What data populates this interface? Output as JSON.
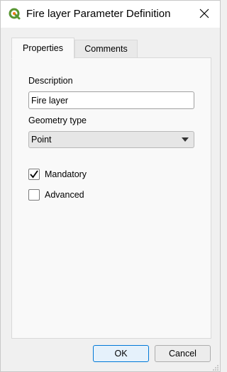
{
  "window": {
    "title": "Fire layer Parameter Definition",
    "app_icon": "qgis-logo-icon",
    "close_icon": "close-icon"
  },
  "tabs": [
    {
      "label": "Properties",
      "active": true
    },
    {
      "label": "Comments",
      "active": false
    }
  ],
  "properties": {
    "description_label": "Description",
    "description_value": "Fire layer",
    "geometry_type_label": "Geometry type",
    "geometry_type_value": "Point",
    "mandatory_label": "Mandatory",
    "mandatory_checked": true,
    "advanced_label": "Advanced",
    "advanced_checked": false
  },
  "buttons": {
    "ok_label": "OK",
    "cancel_label": "Cancel"
  },
  "colors": {
    "accent": "#0078d7",
    "qgis_green": "#589632",
    "qgis_yellow": "#ee7913"
  }
}
